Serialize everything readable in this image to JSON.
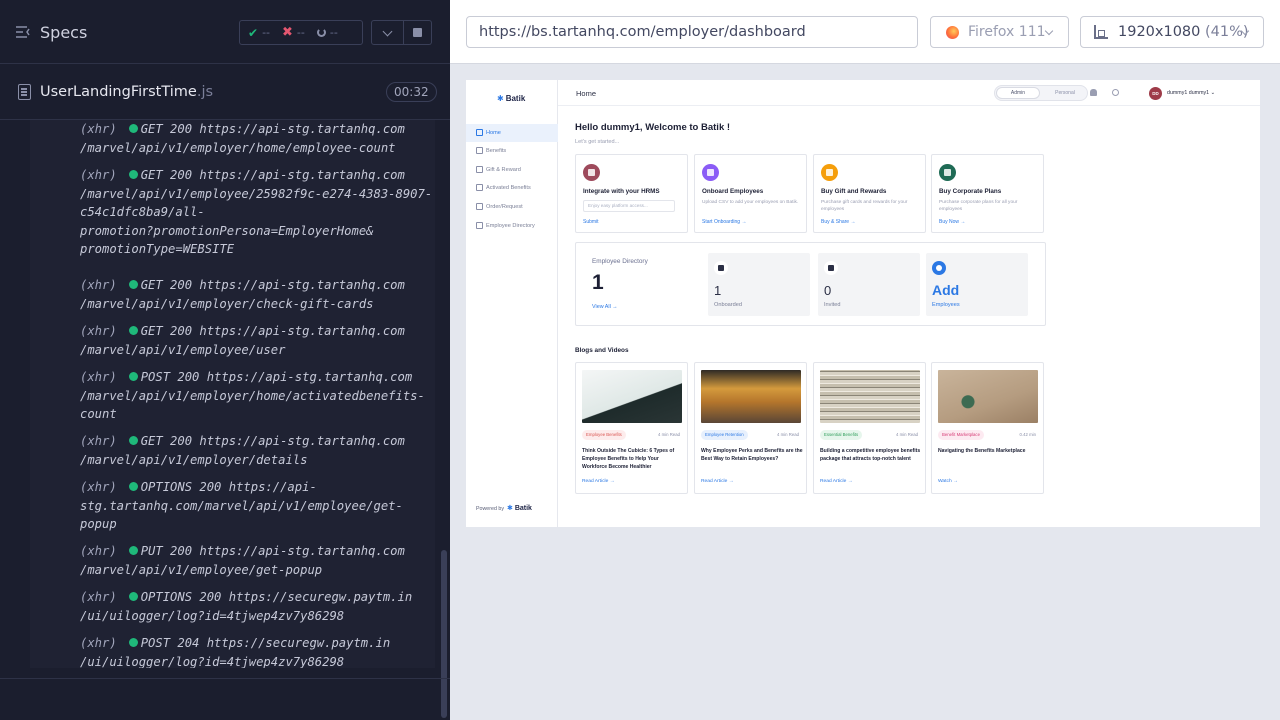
{
  "runner": {
    "specs_title": "Specs",
    "stats": {
      "passed": "--",
      "failed": "--",
      "pending": "--"
    },
    "spec_file": {
      "name": "UserLandingFirstTime",
      "ext": ".js",
      "duration": "00:32"
    },
    "log": [
      {
        "type": "(xhr)",
        "text": "GET 200 https://api-stg.tartanhq.com\n/marvel/api/v1/employer/home/employee-count"
      },
      {
        "type": "(xhr)",
        "text": "GET 200 https://api-stg.tartanhq.com\n/marvel/api/v1/employee/25982f9c-e274-4383-8907-\nc54c1dfc8ba9/all-\npromotion?promotionPersona=EmployerHome&\npromotionType=WEBSITE"
      },
      {
        "type": "(xhr)",
        "text": "GET 200 https://api-stg.tartanhq.com\n/marvel/api/v1/employer/check-gift-cards"
      },
      {
        "type": "(xhr)",
        "text": "GET 200 https://api-stg.tartanhq.com\n/marvel/api/v1/employee/user"
      },
      {
        "type": "(xhr)",
        "text": "POST 200 https://api-stg.tartanhq.com\n/marvel/api/v1/employer/home/activatedbenefits-\ncount"
      },
      {
        "type": "(xhr)",
        "text": "GET 200 https://api-stg.tartanhq.com\n/marvel/api/v1/employer/details"
      },
      {
        "type": "(xhr)",
        "text": "OPTIONS 200 https://api-\nstg.tartanhq.com/marvel/api/v1/employee/get-\npopup"
      },
      {
        "type": "(xhr)",
        "text": "PUT 200 https://api-stg.tartanhq.com\n/marvel/api/v1/employee/get-popup"
      },
      {
        "type": "(xhr)",
        "text": "OPTIONS 200 https://securegw.paytm.in\n/ui/uilogger/log?id=4tjwep4zv7y86298"
      },
      {
        "type": "(xhr)",
        "text": "POST 204 https://securegw.paytm.in\n/ui/uilogger/log?id=4tjwep4zv7y86298"
      }
    ]
  },
  "aut_bar": {
    "url": "https://bs.tartanhq.com/employer/dashboard",
    "browser": "Firefox 111",
    "viewport": "1920x1080",
    "viewport_pct": "(41%)"
  },
  "app": {
    "logo": "Batik",
    "nav": [
      "Home",
      "Benefits",
      "Gift & Reward",
      "Activated Benefits",
      "Order/Request",
      "Employee Directory"
    ],
    "powered_by": "Powered by",
    "breadcrumb": "Home",
    "role_toggle": {
      "admin": "Admin",
      "personal": "Personal"
    },
    "avatar_initials": "DD",
    "user_name": "dummy1 dummy1",
    "greeting": "Hello dummy1, Welcome to Batik !",
    "subtitle": "Let's get started...",
    "cards": [
      {
        "title": "Integrate with your HRMS",
        "desc": "",
        "input_placeholder": "Enjoy easy platform access...",
        "link": "Submit",
        "color": "#9e4a5c"
      },
      {
        "title": "Onboard Employees",
        "desc": "Upload CSV to add your employees on Batik.",
        "link": "Start Onboarding",
        "color": "#8b5cf6"
      },
      {
        "title": "Buy Gift and Rewards",
        "desc": "Purchase gift cards and rewards for your employees",
        "link": "Buy & Share",
        "color": "#f59e0b"
      },
      {
        "title": "Buy Corporate Plans",
        "desc": "Purchase corporate plans for all your employees",
        "link": "Buy Now",
        "color": "#1f6b55"
      }
    ],
    "directory": {
      "title": "Employee Directory",
      "count": "1",
      "view_all": "View All",
      "onboarded_value": "1",
      "onboarded_label": "Onboarded",
      "invited_value": "0",
      "invited_label": "Invited",
      "add_value": "Add",
      "add_label": "Employees"
    },
    "blogs_title": "Blogs and Videos",
    "blogs": [
      {
        "tag": "Employee Benefits",
        "read": "4 min Read",
        "title": "Think Outside The Cubicle: 6 Types of Employee Benefits to Help Your Workforce Become Healthier",
        "link": "Read Article"
      },
      {
        "tag": "Employee Retention",
        "read": "4 min Read",
        "title": "Why Employee Perks and Benefits are the Best Way to Retain Employees?",
        "link": "Read Article"
      },
      {
        "tag": "Essential Benefits",
        "read": "4 min Read",
        "title": "Building a competitive employee benefits package that attracts top-notch talent",
        "link": "Read Article"
      },
      {
        "tag": "Benefit Marketplace",
        "read": "0.42 min",
        "title": "Navigating the Benefits Marketplace",
        "link": "Watch"
      }
    ]
  }
}
